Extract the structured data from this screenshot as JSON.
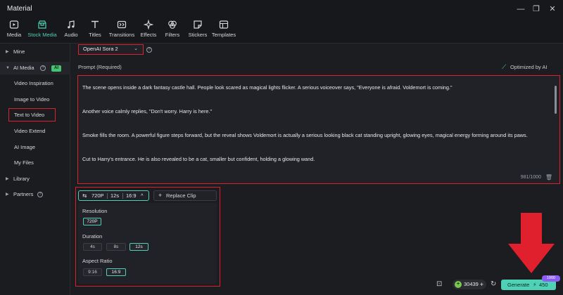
{
  "window": {
    "title": "Material"
  },
  "toolbar": {
    "items": [
      {
        "label": "Media",
        "icon": "media-icon"
      },
      {
        "label": "Stock Media",
        "icon": "stock-media-icon",
        "active": true
      },
      {
        "label": "Audio",
        "icon": "music-note-icon"
      },
      {
        "label": "Titles",
        "icon": "text-t-icon"
      },
      {
        "label": "Transitions",
        "icon": "transitions-icon"
      },
      {
        "label": "Effects",
        "icon": "effects-sparkle-icon"
      },
      {
        "label": "Filters",
        "icon": "filters-icon"
      },
      {
        "label": "Stickers",
        "icon": "sticker-icon"
      },
      {
        "label": "Templates",
        "icon": "templates-icon"
      }
    ]
  },
  "sidebar": {
    "mine": "Mine",
    "ai_media": "AI Media",
    "ai_badge": "AI",
    "ai_items": [
      "Video Inspiration",
      "Image to Video",
      "Text to Video",
      "Video Extend",
      "AI Image",
      "My Files"
    ],
    "library": "Library",
    "partners": "Partners"
  },
  "model": {
    "selected": "OpenAI Sora 2"
  },
  "prompt": {
    "label": "Prompt (Required)",
    "optimized_label": "Optimized by AI",
    "lines": [
      "The scene opens inside a dark fantasy castle hall. People look scared as magical lights flicker. A serious voiceover says, \"Everyone is afraid. Voldemort is coming.\"",
      "Another voice calmly replies, \"Don't worry. Harry is here.\"",
      "Smoke fills the room. A powerful figure steps forward, but the reveal shows Voldemort is actually a serious looking black cat standing upright, glowing eyes, magical energy forming around its paws.",
      "Cut to Harry's entrance. He is also revealed to be a cat, smaller but confident, holding a glowing wand."
    ],
    "char_count": "981/1000"
  },
  "settings": {
    "summary": {
      "resolution": "720P",
      "duration": "12s",
      "aspect": "16:9"
    },
    "replace_clip": "Replace Clip",
    "resolution_label": "Resolution",
    "resolution_options": [
      "720P"
    ],
    "duration_label": "Duration",
    "duration_options": [
      "4s",
      "8s",
      "12s"
    ],
    "aspect_label": "Aspect Ratio",
    "aspect_options": [
      "9:16",
      "16:9"
    ]
  },
  "footer": {
    "credits": "30439",
    "generate_label": "Generate",
    "generate_cost": "450",
    "badge": "1900"
  },
  "colors": {
    "accent": "#4fd1b5",
    "highlight": "#d8232f",
    "background": "#1c1d21"
  }
}
